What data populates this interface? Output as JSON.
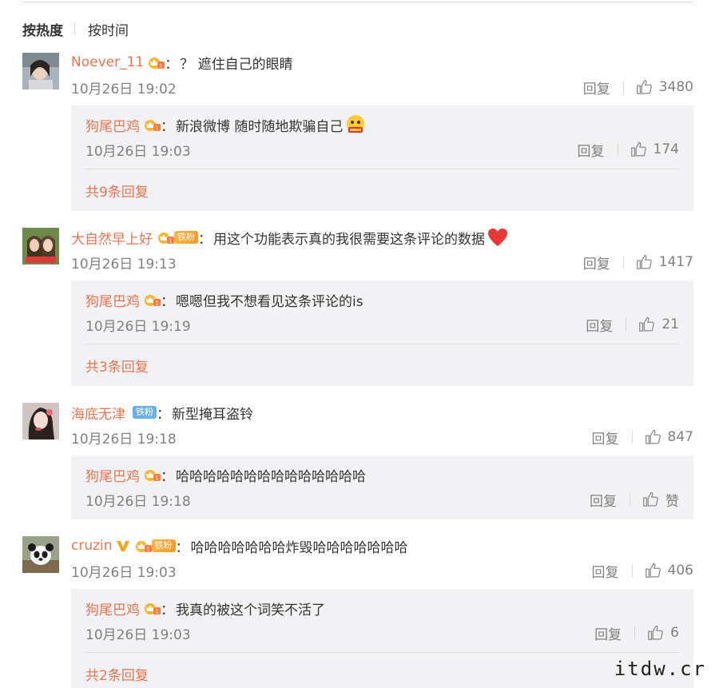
{
  "sort": {
    "hot": "按热度",
    "time": "按时间"
  },
  "comments": [
    {
      "user": "Noever_11",
      "colon": "：",
      "text": "？ 遮住自己的眼睛",
      "time": "10月26日 19:02",
      "reply_label": "回复",
      "likes": "3480",
      "replies": [
        {
          "user": "狗尾巴鸡",
          "colon": "：",
          "text": "新浪微博 随时随地欺骗自己",
          "time": "10月26日 19:03",
          "reply_label": "回复",
          "likes": "174"
        }
      ],
      "more": "共9条回复"
    },
    {
      "user": "大自然早上好",
      "fan_tag": "铁粉",
      "colon": "：",
      "text": "用这个功能表示真的我很需要这条评论的数据",
      "time": "10月26日 19:13",
      "reply_label": "回复",
      "likes": "1417",
      "replies": [
        {
          "user": "狗尾巴鸡",
          "colon": "：",
          "text": "嗯嗯但我不想看见这条评论的is",
          "time": "10月26日 19:19",
          "reply_label": "回复",
          "likes": "21"
        }
      ],
      "more": "共3条回复"
    },
    {
      "user": "海底无津",
      "fan_tag": "铁粉",
      "colon": "：",
      "text": "新型掩耳盗铃",
      "time": "10月26日 19:18",
      "reply_label": "回复",
      "likes": "847",
      "replies": [
        {
          "user": "狗尾巴鸡",
          "colon": "：",
          "text": "哈哈哈哈哈哈哈哈哈哈哈哈哈哈",
          "time": "10月26日 19:18",
          "reply_label": "回复",
          "likes": "赞"
        }
      ]
    },
    {
      "user": "cruzin",
      "fan_tag": "铁粉",
      "colon": "：",
      "text": "哈哈哈哈哈哈哈炸毁哈哈哈哈哈哈哈",
      "time": "10月26日 19:03",
      "reply_label": "回复",
      "likes": "406",
      "replies": [
        {
          "user": "狗尾巴鸡",
          "colon": "：",
          "text": "我真的被这个词笑不活了",
          "time": "10月26日 19:03",
          "reply_label": "回复",
          "likes": "6"
        }
      ],
      "more": "共2条回复"
    }
  ],
  "watermark": "itdw.cr",
  "colors": {
    "username": "#eb7350",
    "meta": "#808080",
    "reply_bg": "#f2f2f5"
  },
  "icons": [
    "thumb-up-icon",
    "crown-badge-icon",
    "vip-v-icon",
    "heart-emoji",
    "zany-face-emoji"
  ]
}
